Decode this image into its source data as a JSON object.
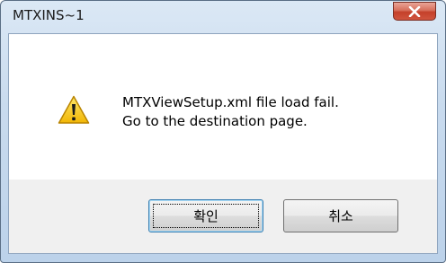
{
  "window": {
    "title": "MTXINS~1",
    "close_symbol": "x"
  },
  "dialog": {
    "icon": "warning-icon",
    "message_lines": [
      "MTXViewSetup.xml file load fail.",
      "Go to the destination page."
    ]
  },
  "buttons": {
    "ok_label": "확인",
    "cancel_label": "취소"
  },
  "colors": {
    "close_button": "#c4402a",
    "warning_fill": "#f5c81c"
  }
}
